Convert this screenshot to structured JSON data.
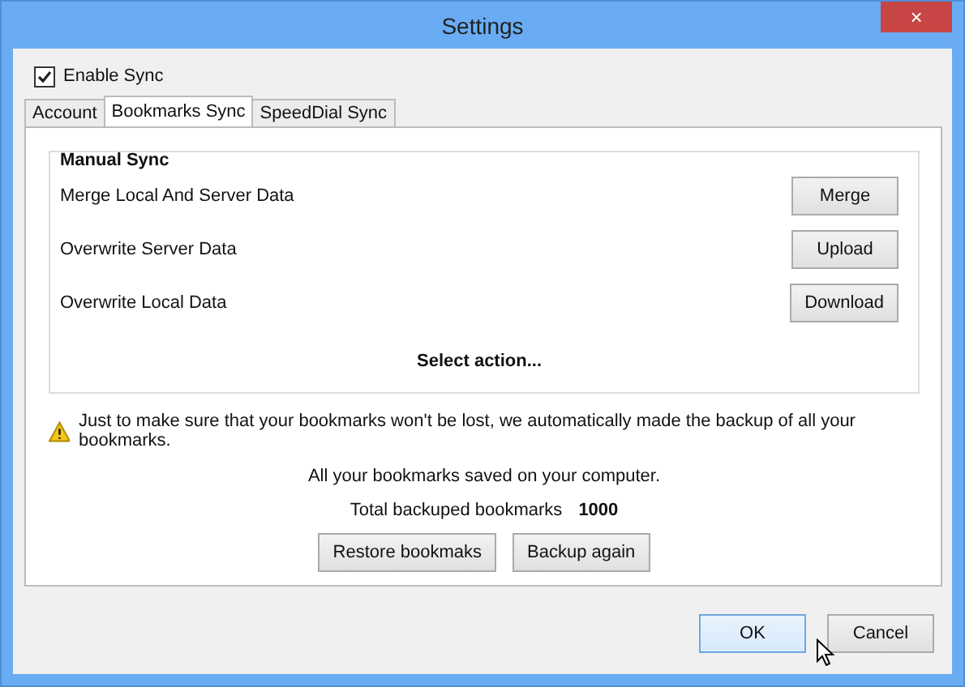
{
  "window": {
    "title": "Settings",
    "close": "×"
  },
  "enable_sync": {
    "label": "Enable Sync",
    "checked": true
  },
  "tabs": [
    {
      "label": "Account",
      "selected": false
    },
    {
      "label": "Bookmarks Sync",
      "selected": true
    },
    {
      "label": "SpeedDial Sync",
      "selected": false
    }
  ],
  "manual_sync": {
    "title": "Manual Sync",
    "rows": [
      {
        "label": "Merge Local And Server Data",
        "button": "Merge"
      },
      {
        "label": "Overwrite Server Data",
        "button": "Upload"
      },
      {
        "label": "Overwrite Local Data",
        "button": "Download"
      }
    ],
    "status": "Select action..."
  },
  "backup": {
    "warning": "Just to make sure that your bookmarks won't be lost, we automatically made the backup of all your bookmarks.",
    "saved": "All your bookmarks saved on your computer.",
    "total_label": "Total backuped bookmarks",
    "total_value": "1000",
    "buttons": [
      "Restore bookmaks",
      "Backup again"
    ]
  },
  "footer": {
    "buttons": [
      {
        "label": "OK",
        "selected": true
      },
      {
        "label": "Cancel",
        "selected": false
      }
    ]
  }
}
